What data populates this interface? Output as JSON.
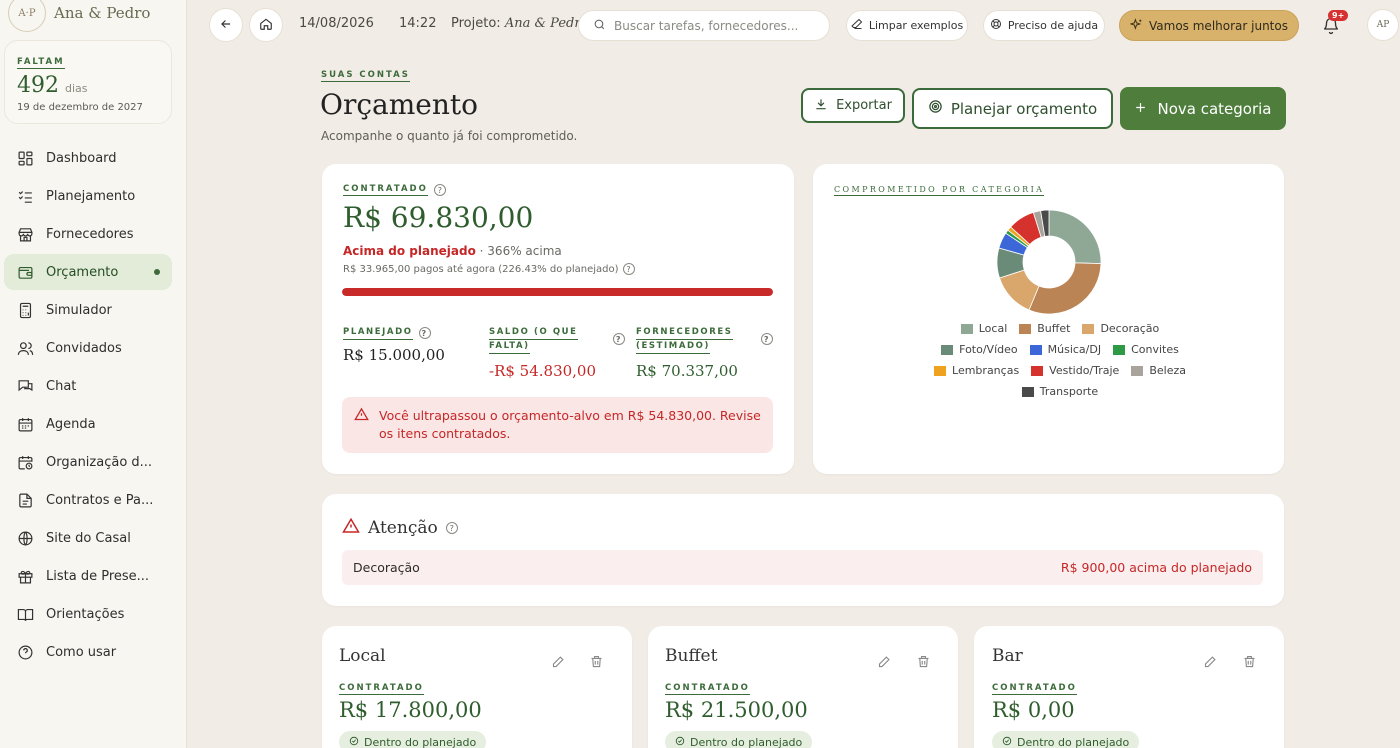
{
  "sidebar": {
    "logo_initials": "A·P",
    "couple_name": "Ana & Pedro",
    "countdown": {
      "label": "FALTAM",
      "days": "492",
      "unit": "dias",
      "date": "19 de dezembro de 2027"
    },
    "items": [
      {
        "label": "Dashboard",
        "icon": "dashboard-icon"
      },
      {
        "label": "Planejamento",
        "icon": "checklist-icon"
      },
      {
        "label": "Fornecedores",
        "icon": "store-icon"
      },
      {
        "label": "Orçamento",
        "icon": "wallet-icon",
        "active": true
      },
      {
        "label": "Simulador",
        "icon": "calculator-icon"
      },
      {
        "label": "Convidados",
        "icon": "users-icon"
      },
      {
        "label": "Chat",
        "icon": "chat-icon"
      },
      {
        "label": "Agenda",
        "icon": "calendar-icon"
      },
      {
        "label": "Organização d...",
        "icon": "calendar-clock-icon"
      },
      {
        "label": "Contratos e Pa...",
        "icon": "document-icon"
      },
      {
        "label": "Site do Casal",
        "icon": "globe-icon"
      },
      {
        "label": "Lista de Prese...",
        "icon": "gift-icon"
      },
      {
        "label": "Orientações",
        "icon": "book-icon"
      },
      {
        "label": "Como usar",
        "icon": "help-icon"
      }
    ]
  },
  "topbar": {
    "date": "14/08/2026",
    "time": "14:22",
    "project_label": "Projeto:",
    "project_name": "Ana & Pedro",
    "search_placeholder": "Buscar tarefas, fornecedores...",
    "clear_examples": "Limpar exemplos",
    "need_help": "Preciso de ajuda",
    "improve": "Vamos melhorar juntos",
    "notifications_badge": "9+",
    "avatar_initials": "AP"
  },
  "header": {
    "kicker": "SUAS CONTAS",
    "title": "Orçamento",
    "subtitle": "Acompanhe o quanto já foi comprometido.",
    "export_label": "Exportar",
    "plan_label": "Planejar orçamento",
    "new_category_label": "Nova categoria"
  },
  "summary": {
    "kicker": "CONTRATADO",
    "amount": "R$ 69.830,00",
    "status": "Acima do planejado",
    "status_detail": "· 366% acima",
    "paid_note": "R$ 33.965,00 pagos até agora (226.43% do planejado)",
    "progress_percent": 100,
    "planned_label": "PLANEJADO",
    "planned_value": "R$ 15.000,00",
    "balance_label_1": "SALDO (O QUE",
    "balance_label_2": "FALTA)",
    "balance_value": "-R$ 54.830,00",
    "suppliers_label_1": "FORNECEDORES",
    "suppliers_label_2": "(ESTIMADO)",
    "suppliers_value": "R$ 70.337,00",
    "alert": "Você ultrapassou o orçamento-alvo em R$ 54.830,00. Revise os itens contratados."
  },
  "chart_data": {
    "type": "pie",
    "title": "COMPROMETIDO POR CATEGORIA",
    "categories": [
      "Local",
      "Buffet",
      "Decoração",
      "Foto/Vídeo",
      "Música/DJ",
      "Convites",
      "Lembranças",
      "Vestido/Traje",
      "Beleza",
      "Transporte"
    ],
    "values": [
      17800,
      21500,
      9600,
      6500,
      3500,
      800,
      900,
      5830,
      1600,
      1800
    ],
    "colors": [
      "#8fa795",
      "#bb8454",
      "#d9a66c",
      "#6a8b78",
      "#3b67d8",
      "#2e9a46",
      "#efa21f",
      "#d6322d",
      "#a8a49c",
      "#4a4a4a"
    ],
    "legend": "bottom"
  },
  "attention": {
    "title": "Atenção",
    "row_label": "Decoração",
    "row_amount": "R$ 900,00 acima do planejado"
  },
  "categories": [
    {
      "name": "Local",
      "label": "CONTRATADO",
      "amount": "R$ 17.800,00",
      "status": "Dentro do planejado"
    },
    {
      "name": "Buffet",
      "label": "CONTRATADO",
      "amount": "R$ 21.500,00",
      "status": "Dentro do planejado"
    },
    {
      "name": "Bar",
      "label": "CONTRATADO",
      "amount": "R$ 0,00",
      "status": "Dentro do planejado"
    }
  ]
}
